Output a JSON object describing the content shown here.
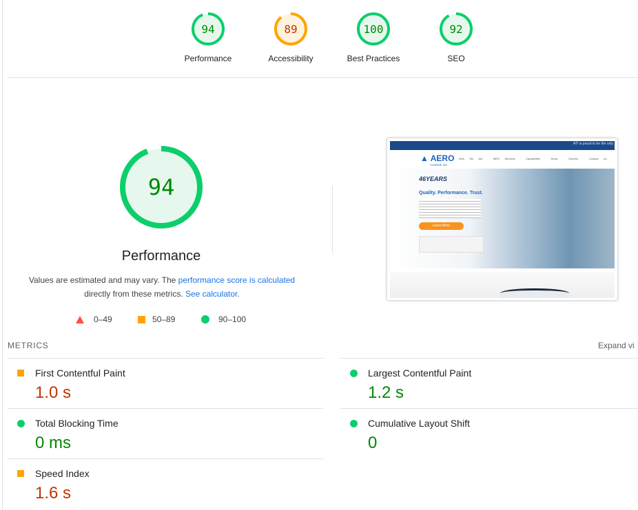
{
  "categories": [
    {
      "score": "94",
      "label": "Performance",
      "color": "#0cce6b",
      "text": "#008800",
      "bg": "#e6f8ee",
      "fraction": 0.94
    },
    {
      "score": "89",
      "label": "Accessibility",
      "color": "#ffa400",
      "text": "#c33300",
      "bg": "#fff3e0",
      "fraction": 0.89
    },
    {
      "score": "100",
      "label": "Best Practices",
      "color": "#0cce6b",
      "text": "#008800",
      "bg": "#e6f8ee",
      "fraction": 1.0
    },
    {
      "score": "92",
      "label": "SEO",
      "color": "#0cce6b",
      "text": "#008800",
      "bg": "#e6f8ee",
      "fraction": 0.92
    }
  ],
  "main": {
    "score": "94",
    "fraction": 0.94,
    "title": "Performance",
    "desc_prefix": "Values are estimated and may vary. The ",
    "desc_link1": "performance score is calculated",
    "desc_mid": "directly from these metrics. ",
    "desc_link2": "See calculator",
    "desc_suffix": "."
  },
  "legend": [
    "0–49",
    "50–89",
    "90–100"
  ],
  "screenshot": {
    "logo": "AERO",
    "logo_sub": "TURBINE INC.",
    "badge": "46YEARS",
    "headline": "Quality. Performance. Trust.",
    "cta": "Learn More",
    "ticker": "ATI is proud to be the only"
  },
  "metrics": {
    "heading": "METRICS",
    "expand": "Expand vi",
    "items": [
      {
        "name": "First Contentful Paint",
        "value": "1.0 s",
        "status": "average"
      },
      {
        "name": "Largest Contentful Paint",
        "value": "1.2 s",
        "status": "pass"
      },
      {
        "name": "Total Blocking Time",
        "value": "0 ms",
        "status": "pass"
      },
      {
        "name": "Cumulative Layout Shift",
        "value": "0",
        "status": "pass"
      },
      {
        "name": "Speed Index",
        "value": "1.6 s",
        "status": "average"
      }
    ]
  }
}
